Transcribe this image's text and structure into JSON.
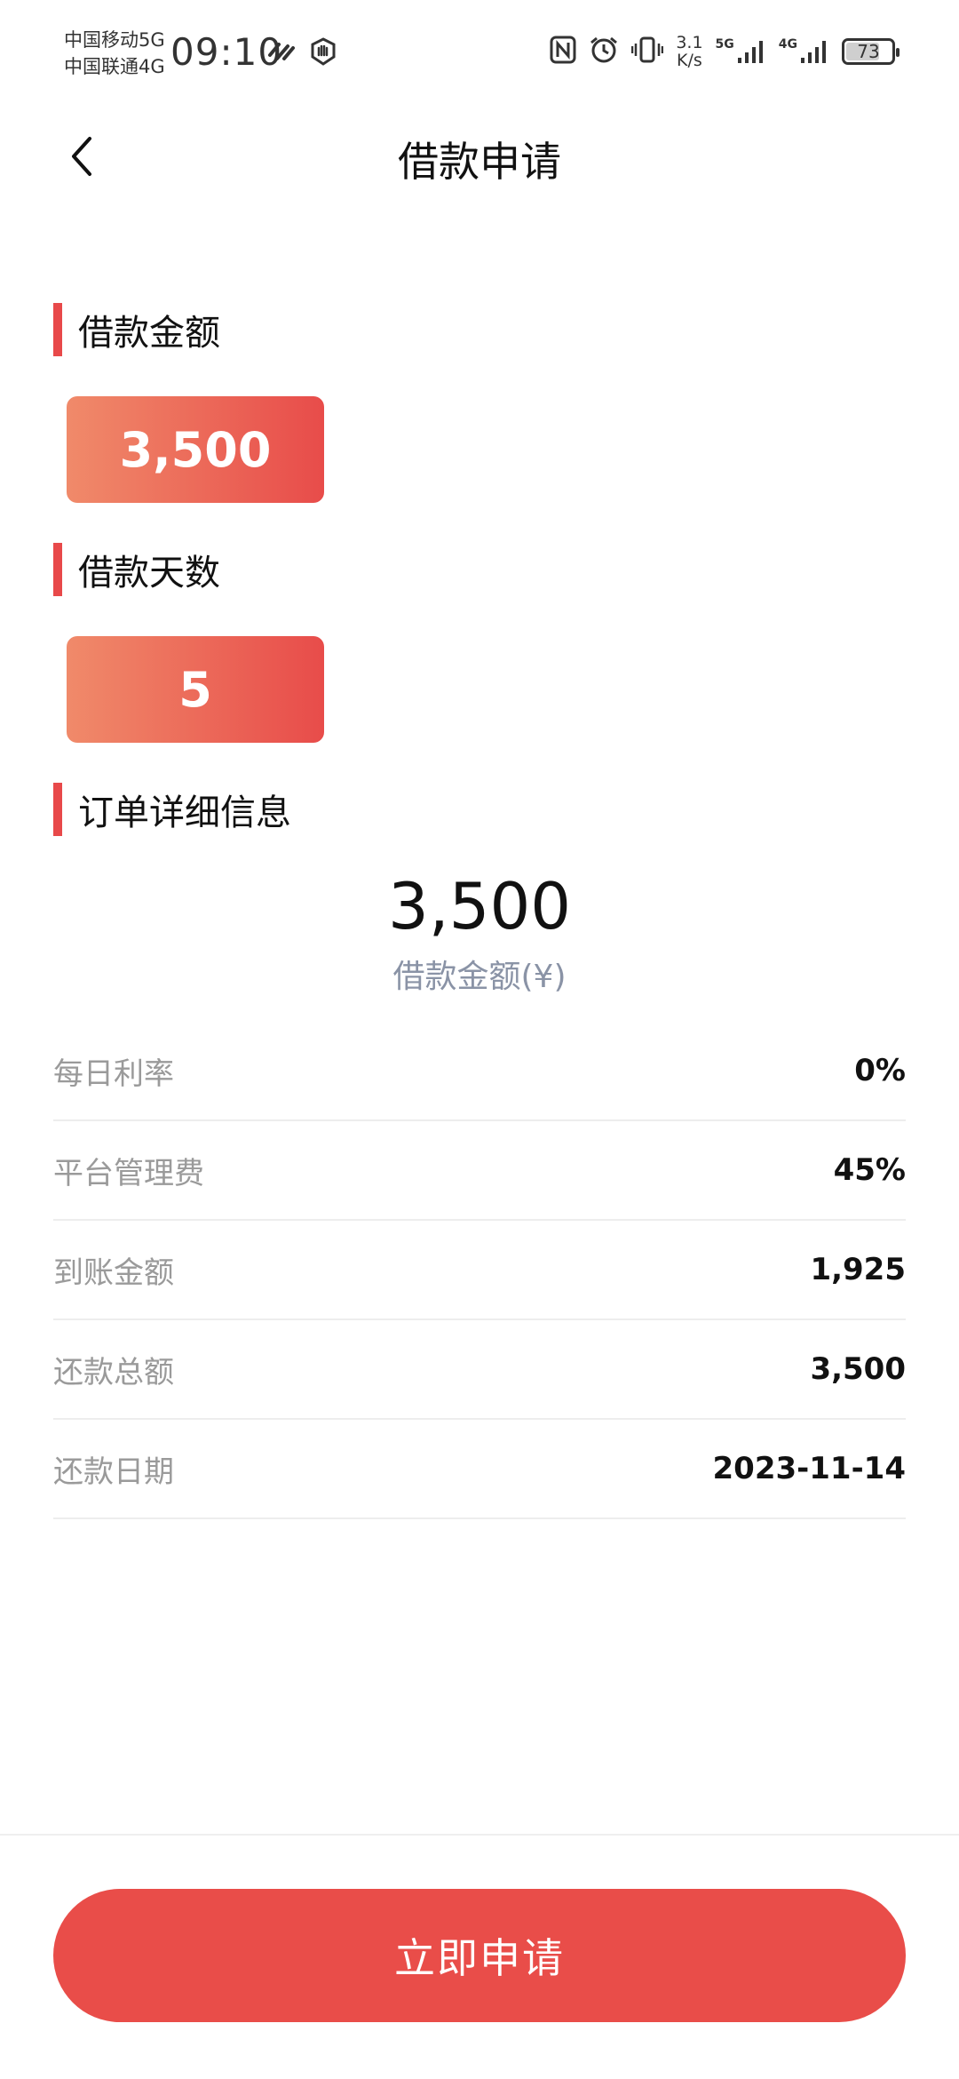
{
  "status_bar": {
    "carrier_1": "中国移动5G",
    "carrier_2": "中国联通4G",
    "time": "09:10",
    "net_speed_value": "3.1",
    "net_speed_unit": "K/s",
    "signal_1_label": "5G",
    "signal_2_label": "4G",
    "battery_percent": "73",
    "battery_level": 0.73
  },
  "header": {
    "title": "借款申请"
  },
  "loan_amount": {
    "label": "借款金额",
    "value": "3,500"
  },
  "loan_days": {
    "label": "借款天数",
    "value": "5"
  },
  "order_details": {
    "label": "订单详细信息",
    "amount": "3,500",
    "amount_caption": "借款金额(¥)",
    "rows": [
      {
        "label": "每日利率",
        "value": "0%"
      },
      {
        "label": "平台管理费",
        "value": "45%"
      },
      {
        "label": "到账金额",
        "value": "1,925"
      },
      {
        "label": "还款总额",
        "value": "3,500"
      },
      {
        "label": "还款日期",
        "value": "2023-11-14"
      }
    ]
  },
  "footer": {
    "apply_label": "立即申请"
  },
  "colors": {
    "accent": "#e84c4a",
    "gradient_start": "#f08a6a",
    "gradient_end": "#e84c4a",
    "muted_text": "#9a9a9a",
    "caption_text": "#8a93a6"
  }
}
